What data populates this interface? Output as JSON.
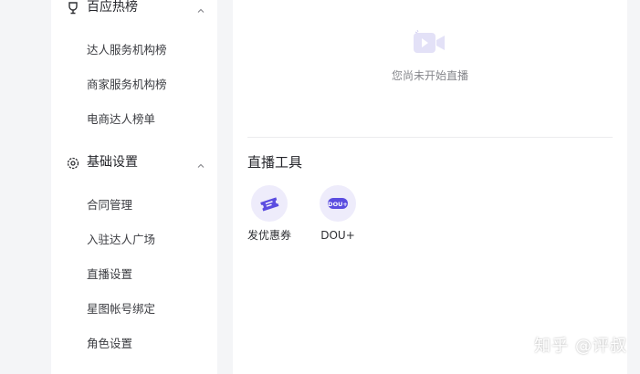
{
  "sidebar": {
    "sections": [
      {
        "title": "百应热榜",
        "icon": "trophy-icon",
        "items": [
          "达人服务机构榜",
          "商家服务机构榜",
          "电商达人榜单"
        ]
      },
      {
        "title": "基础设置",
        "icon": "gear-icon",
        "items": [
          "合同管理",
          "入驻达人广场",
          "直播设置",
          "星图帐号绑定",
          "角色设置"
        ]
      }
    ]
  },
  "main": {
    "empty_state": {
      "icon": "video-camera-icon",
      "text": "您尚未开始直播"
    },
    "tools": {
      "title": "直播工具",
      "items": [
        {
          "label": "发优惠券",
          "icon": "coupon-icon"
        },
        {
          "label": "DOU+",
          "icon": "dou-plus-icon",
          "badge": "DOU+"
        }
      ]
    }
  },
  "watermark": "知乎 @评叔",
  "colors": {
    "accent": "#5b4de0",
    "accent_light": "#eeecfb",
    "background": "#f4f5f7",
    "panel": "#ffffff"
  }
}
